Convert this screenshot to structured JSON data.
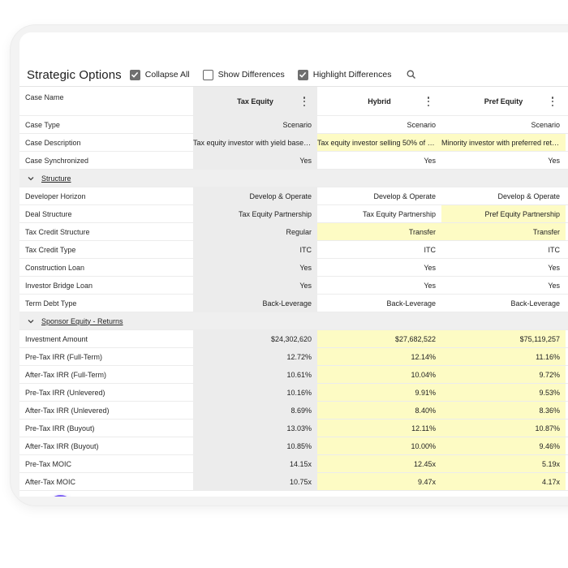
{
  "header": {
    "title": "Strategic Options",
    "collapse_all": {
      "label": "Collapse All",
      "checked": true
    },
    "show_differences": {
      "label": "Show Differences",
      "checked": false
    },
    "highlight_differences": {
      "label": "Highlight Differences",
      "checked": true
    }
  },
  "columns": {
    "case_name_label": "Case Name",
    "col1": "Tax Equity",
    "col2": "Hybrid",
    "col3": "Pref Equity"
  },
  "rows": [
    {
      "label": "Case Type",
      "v": [
        "Scenario",
        "Scenario",
        "Scenario"
      ],
      "hl": [
        false,
        false,
        false
      ]
    },
    {
      "label": "Case Description",
      "v": [
        "Tax equity investor with yield based flip",
        "Tax equity investor selling 50% of credits",
        "Minority investor with preferred return"
      ],
      "hl": [
        false,
        true,
        true
      ]
    },
    {
      "label": "Case Synchronized",
      "v": [
        "Yes",
        "Yes",
        "Yes"
      ],
      "hl": [
        false,
        false,
        false
      ]
    }
  ],
  "section_structure": {
    "label": "Structure",
    "rows": [
      {
        "label": "Developer Horizon",
        "v": [
          "Develop & Operate",
          "Develop & Operate",
          "Develop & Operate"
        ],
        "hl": [
          false,
          false,
          false
        ]
      },
      {
        "label": "Deal Structure",
        "v": [
          "Tax Equity Partnership",
          "Tax Equity Partnership",
          "Pref Equity Partnership"
        ],
        "hl": [
          false,
          false,
          true
        ]
      },
      {
        "label": "Tax Credit Structure",
        "v": [
          "Regular",
          "Transfer",
          "Transfer"
        ],
        "hl": [
          false,
          true,
          true
        ]
      },
      {
        "label": "Tax Credit Type",
        "v": [
          "ITC",
          "ITC",
          "ITC"
        ],
        "hl": [
          false,
          false,
          false
        ]
      },
      {
        "label": "Construction Loan",
        "v": [
          "Yes",
          "Yes",
          "Yes"
        ],
        "hl": [
          false,
          false,
          false
        ]
      },
      {
        "label": "Investor Bridge Loan",
        "v": [
          "Yes",
          "Yes",
          "Yes"
        ],
        "hl": [
          false,
          false,
          false
        ]
      },
      {
        "label": "Term Debt Type",
        "v": [
          "Back-Leverage",
          "Back-Leverage",
          "Back-Leverage"
        ],
        "hl": [
          false,
          false,
          false
        ]
      }
    ]
  },
  "section_returns": {
    "label": "Sponsor Equity - Returns",
    "rows": [
      {
        "label": "Investment Amount",
        "v": [
          "$24,302,620",
          "$27,682,522",
          "$75,119,257"
        ],
        "hl": [
          false,
          true,
          true
        ]
      },
      {
        "label": "Pre-Tax IRR (Full-Term)",
        "v": [
          "12.72%",
          "12.14%",
          "11.16%"
        ],
        "hl": [
          false,
          true,
          true
        ]
      },
      {
        "label": "After-Tax IRR (Full-Term)",
        "v": [
          "10.61%",
          "10.04%",
          "9.72%"
        ],
        "hl": [
          false,
          true,
          true
        ]
      },
      {
        "label": "Pre-Tax IRR (Unlevered)",
        "v": [
          "10.16%",
          "9.91%",
          "9.53%"
        ],
        "hl": [
          false,
          true,
          true
        ]
      },
      {
        "label": "After-Tax IRR (Unlevered)",
        "v": [
          "8.69%",
          "8.40%",
          "8.36%"
        ],
        "hl": [
          false,
          true,
          true
        ]
      },
      {
        "label": "Pre-Tax IRR (Buyout)",
        "v": [
          "13.03%",
          "12.11%",
          "10.87%"
        ],
        "hl": [
          false,
          true,
          true
        ]
      },
      {
        "label": "After-Tax IRR (Buyout)",
        "v": [
          "10.85%",
          "10.00%",
          "9.46%"
        ],
        "hl": [
          false,
          true,
          true
        ]
      },
      {
        "label": "Pre-Tax MOIC",
        "v": [
          "14.15x",
          "12.45x",
          "5.19x"
        ],
        "hl": [
          false,
          true,
          true
        ]
      },
      {
        "label": "After-Tax MOIC",
        "v": [
          "10.75x",
          "9.47x",
          "4.17x"
        ],
        "hl": [
          false,
          true,
          true
        ]
      }
    ]
  },
  "icons": {
    "checkbox_checked": "check-icon",
    "search": "search-icon",
    "kebab": "kebab-menu-icon",
    "section_toggle": "chevron-down-icon",
    "chat": "chat-bubble-icon"
  },
  "colors": {
    "highlight": "#fdfbc4",
    "baseline_column": "#ececec",
    "section_background": "#efefef",
    "chat_accent": "#7a5cf5"
  }
}
